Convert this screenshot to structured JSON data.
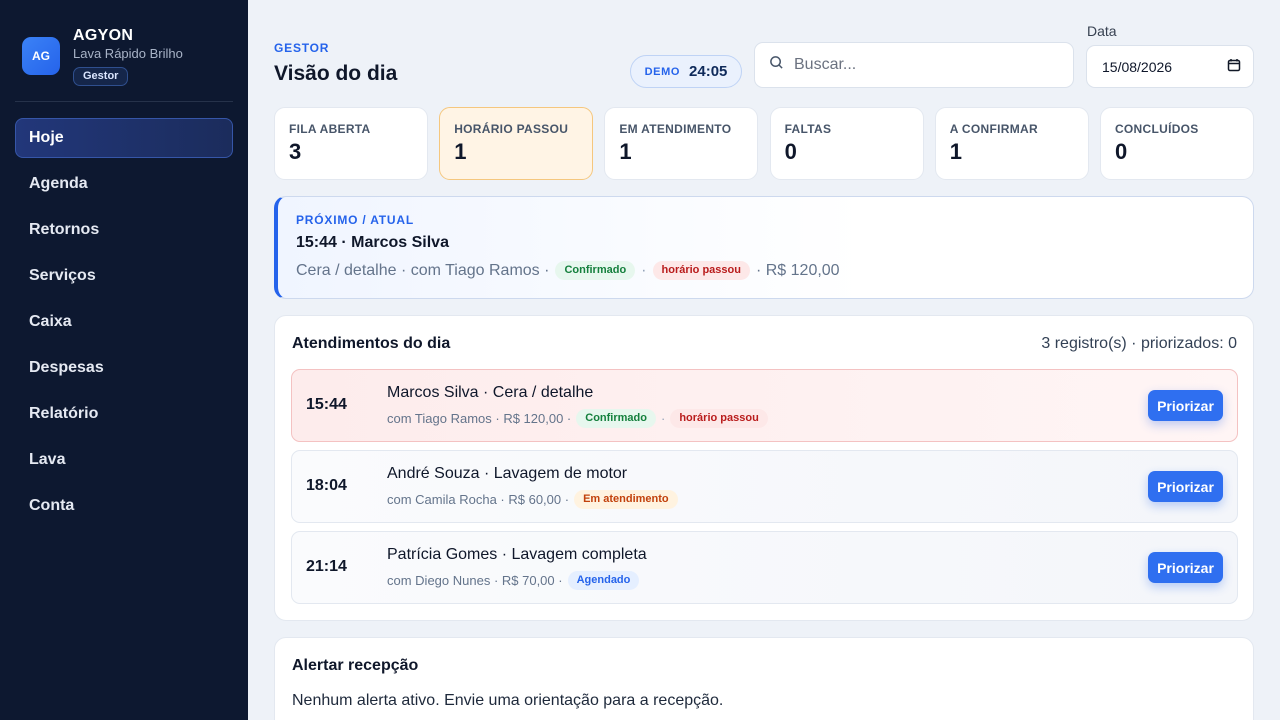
{
  "sidebar": {
    "logo": "AG",
    "brand_name": "AGYON",
    "brand_sub": "Lava Rápido Brilho",
    "role": "Gestor",
    "items": [
      {
        "label": "Hoje"
      },
      {
        "label": "Agenda"
      },
      {
        "label": "Retornos"
      },
      {
        "label": "Serviços"
      },
      {
        "label": "Caixa"
      },
      {
        "label": "Despesas"
      },
      {
        "label": "Relatório"
      },
      {
        "label": "Lava"
      },
      {
        "label": "Conta"
      }
    ]
  },
  "header": {
    "eyebrow": "GESTOR",
    "title": "Visão do dia",
    "demo_label": "DEMO",
    "demo_time": "24:05",
    "search_placeholder": "Buscar...",
    "date_label": "Data",
    "date_value": "15/08/2026"
  },
  "stats": [
    {
      "label": "FILA ABERTA",
      "value": "3"
    },
    {
      "label": "HORÁRIO PASSOU",
      "value": "1"
    },
    {
      "label": "EM ATENDIMENTO",
      "value": "1"
    },
    {
      "label": "FALTAS",
      "value": "0"
    },
    {
      "label": "A CONFIRMAR",
      "value": "1"
    },
    {
      "label": "CONCLUÍDOS",
      "value": "0"
    }
  ],
  "next": {
    "eyebrow": "PRÓXIMO / ATUAL",
    "title": "15:44 · Marcos Silva",
    "service": "Cera / detalhe · com Tiago Ramos ·",
    "chip1": "Confirmado",
    "sep": "·",
    "chip2": "horário passou",
    "price": "· R$ 120,00"
  },
  "appointments": {
    "title": "Atendimentos do dia",
    "count": "3 registro(s) · priorizados: 0",
    "button_label": "Priorizar",
    "rows": [
      {
        "time": "15:44",
        "title": "Marcos Silva · Cera / detalhe",
        "meta": "com Tiago Ramos · R$ 120,00 ·",
        "chip1": "Confirmado",
        "sep": "·",
        "chip2": "horário passou"
      },
      {
        "time": "18:04",
        "title": "André Souza · Lavagem de motor",
        "meta": "com Camila Rocha · R$ 60,00 ·",
        "chip1": "Em atendimento"
      },
      {
        "time": "21:14",
        "title": "Patrícia Gomes · Lavagem completa",
        "meta": "com Diego Nunes · R$ 70,00 ·",
        "chip1": "Agendado"
      }
    ]
  },
  "alert": {
    "title": "Alertar recepção",
    "text": "Nenhum alerta ativo. Envie uma orientação para a recepção."
  },
  "icons": {
    "search": "search-icon",
    "calendar": "calendar-icon"
  }
}
